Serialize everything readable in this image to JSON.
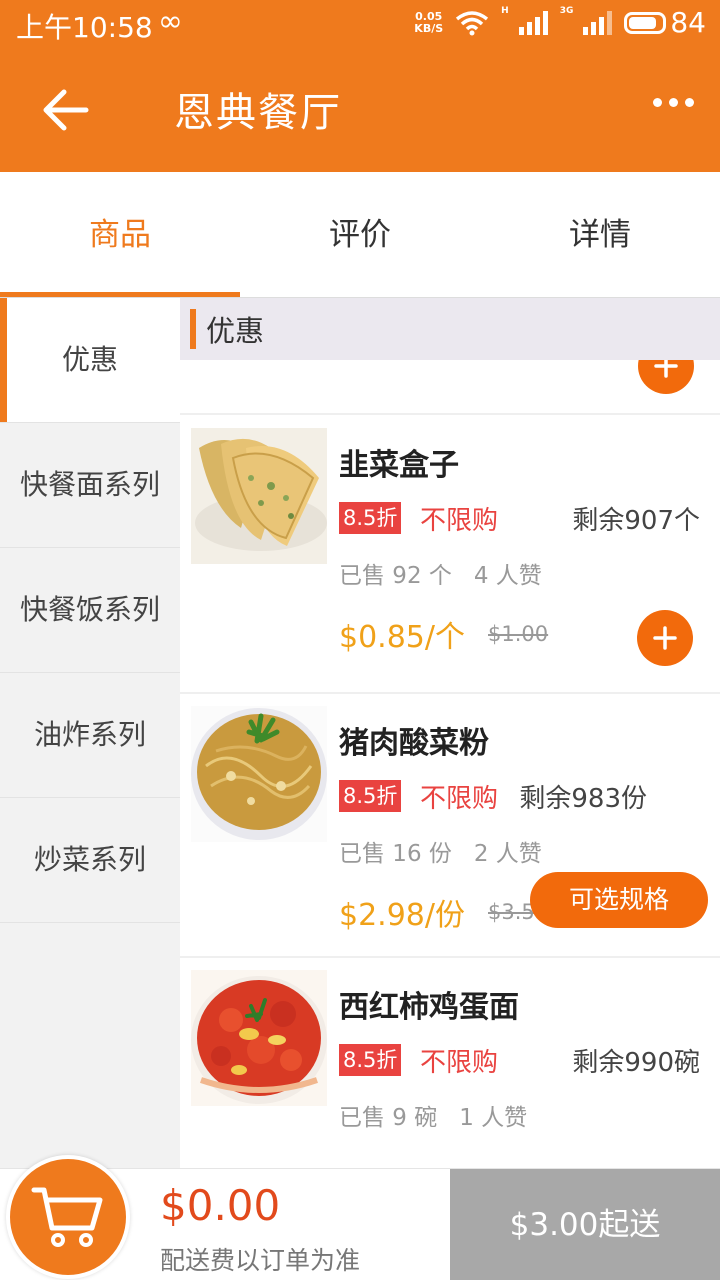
{
  "status_bar": {
    "time": "上午10:58",
    "loop_symbol": "∞",
    "net_speed_value": "0.05",
    "net_speed_unit": "KB/S",
    "signal1_label": "H",
    "signal2_label": "3G",
    "battery": "84",
    "battery_level": 0.84
  },
  "app_bar": {
    "title": "恩典餐厅",
    "back_icon": "arrow-left",
    "menu_icon": "more-dots"
  },
  "tabs": [
    {
      "label": "商品",
      "active": true
    },
    {
      "label": "评价",
      "active": false
    },
    {
      "label": "详情",
      "active": false
    }
  ],
  "sidebar": {
    "items": [
      {
        "label": "优惠",
        "active": true
      },
      {
        "label": "快餐面系列"
      },
      {
        "label": "快餐饭系列"
      },
      {
        "label": "油炸系列"
      },
      {
        "label": "炒菜系列"
      }
    ]
  },
  "section": {
    "title": "优惠"
  },
  "products": [
    {
      "name": "韭菜盒子",
      "discount": "8.5折",
      "limit": "不限购",
      "stock": "剩余907个",
      "sold": "已售 92 个",
      "likes": "4 人赞",
      "price": "$0.85/个",
      "original_price": "$1.00",
      "action": "plus"
    },
    {
      "name": "猪肉酸菜粉",
      "discount": "8.5折",
      "limit": "不限购",
      "stock": "剩余983份",
      "sold": "已售 16 份",
      "likes": "2 人赞",
      "price": "$2.98/份",
      "original_price": "$3.5",
      "action": "可选规格"
    },
    {
      "name": "西红柿鸡蛋面",
      "discount": "8.5折",
      "limit": "不限购",
      "stock": "剩余990碗",
      "sold": "已售 9 碗",
      "likes": "1 人赞",
      "action": "plus"
    }
  ],
  "cart": {
    "total": "$0.00",
    "fee_note": "配送费以订单为准",
    "min_order": "$3.00起送",
    "icon": "shopping-cart"
  },
  "colors": {
    "primary": "#ef7a1d",
    "button": "#f26a0c",
    "discount_badge": "#e94340",
    "price": "#f0a119",
    "total": "#e24a1c",
    "disabled": "#a8a8a8"
  }
}
